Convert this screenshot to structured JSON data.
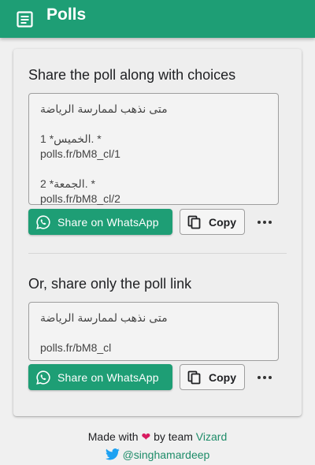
{
  "app": {
    "title": "Polls"
  },
  "section_choices": {
    "heading": "Share the poll along with choices",
    "question": "متى نذهب لممارسة الرياضة",
    "items": [
      {
        "num": "1. *",
        "choice": "الخميس*",
        "link": "polls.fr/bM8_cl/1"
      },
      {
        "num": "2. *",
        "choice": "الجمعة*",
        "link": "polls.fr/bM8_cl/2"
      }
    ],
    "whatsapp_label": "Share on WhatsApp",
    "copy_label": "Copy"
  },
  "section_link": {
    "heading": "Or, share only the poll link",
    "question": "متى نذهب لممارسة الرياضة",
    "link": "polls.fr/bM8_cl",
    "whatsapp_label": "Share on WhatsApp",
    "copy_label": "Copy"
  },
  "footer": {
    "made_with": "Made with",
    "by_team": "by team",
    "team_name": "Vizard",
    "handle": "@singhamardeep"
  },
  "colors": {
    "brand": "#1e9e75",
    "heart": "#d81b60"
  }
}
